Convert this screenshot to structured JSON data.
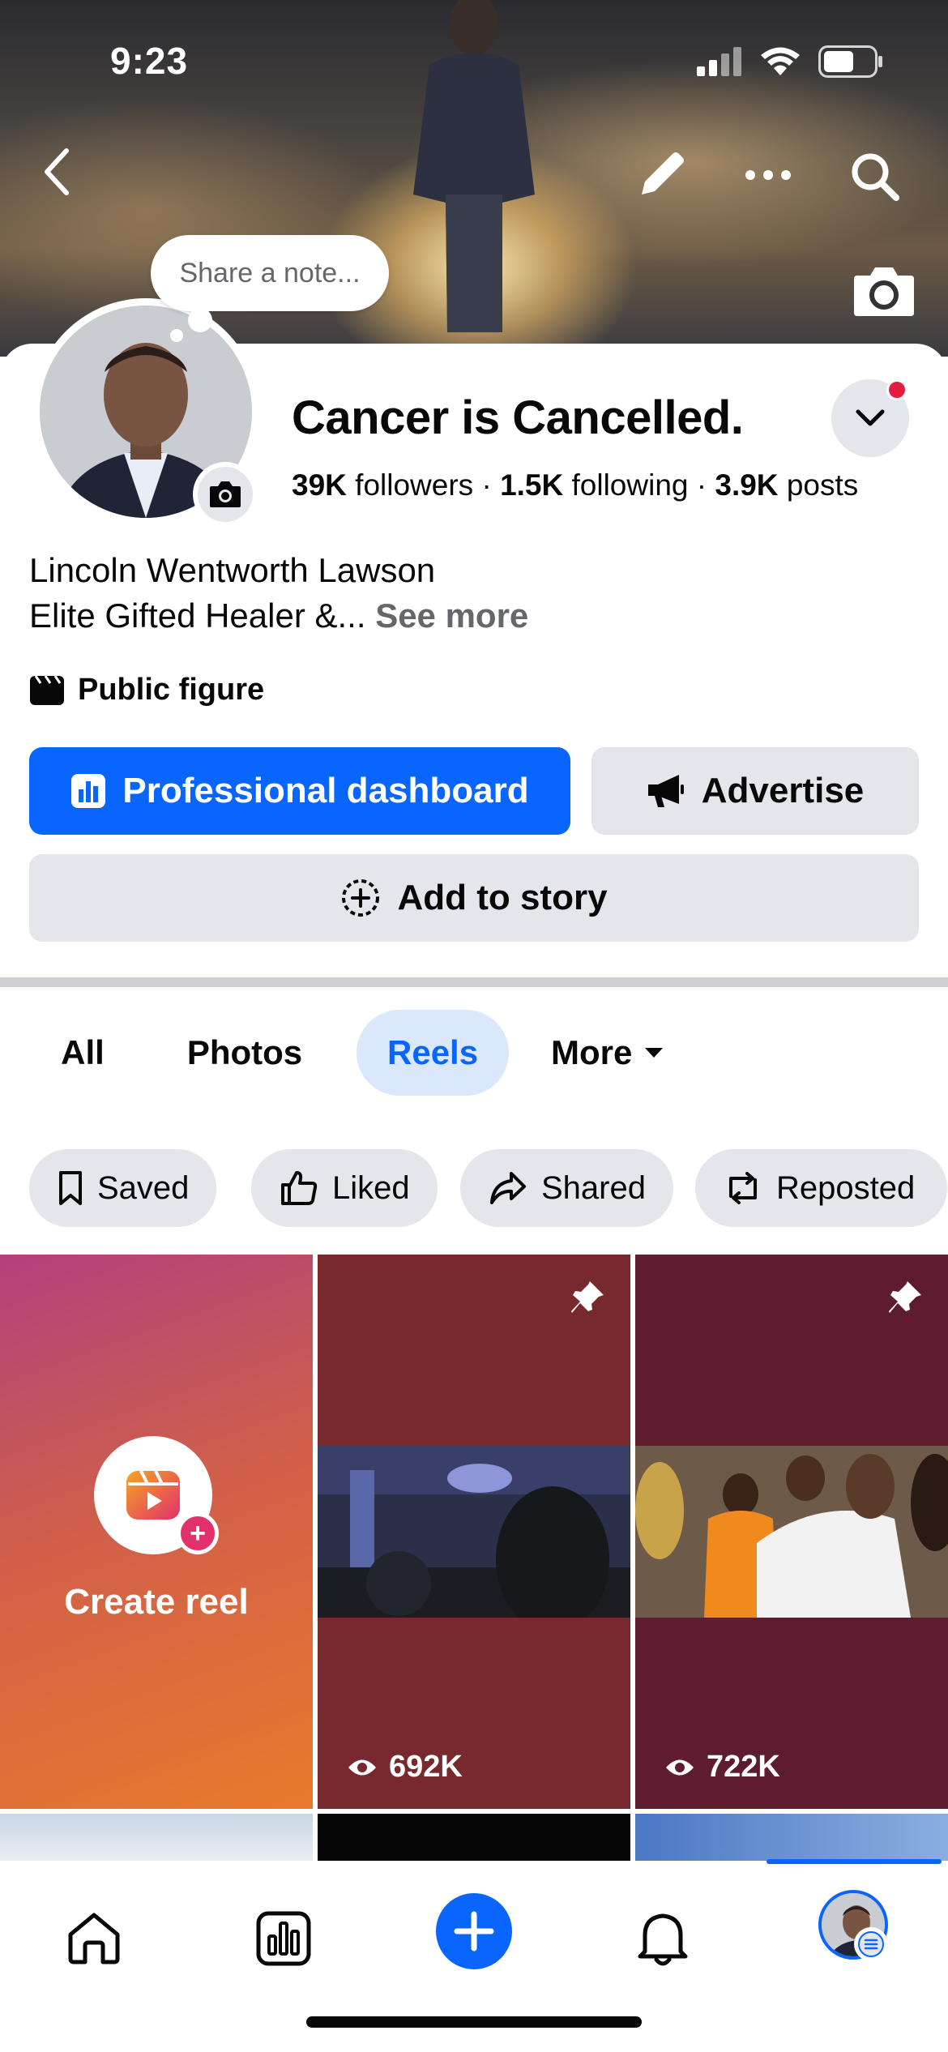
{
  "status_bar": {
    "time": "9:23"
  },
  "header": {
    "back_icon": "chevron-left-icon",
    "edit_icon": "pencil-icon",
    "more_icon": "ellipsis-icon",
    "search_icon": "search-icon",
    "cover_camera_icon": "camera-icon"
  },
  "note": {
    "placeholder": "Share a note..."
  },
  "profile": {
    "name": "Cancer is Cancelled.",
    "followers_count": "39K",
    "followers_label": "followers",
    "following_count": "1.5K",
    "following_label": "following",
    "posts_count": "3.9K",
    "posts_label": "posts",
    "separator": "·",
    "bio_line1": "Lincoln Wentworth Lawson",
    "bio_line2": "Elite Gifted Healer &...",
    "see_more": "See more",
    "category": "Public figure"
  },
  "actions": {
    "professional_dashboard": "Professional dashboard",
    "advertise": "Advertise",
    "add_to_story": "Add to story"
  },
  "tabs": [
    {
      "label": "All"
    },
    {
      "label": "Photos"
    },
    {
      "label": "Reels",
      "active": true
    },
    {
      "label": "More"
    }
  ],
  "filters": [
    {
      "label": "Saved",
      "icon": "bookmark-icon"
    },
    {
      "label": "Liked",
      "icon": "thumbs-up-icon"
    },
    {
      "label": "Shared",
      "icon": "share-arrow-icon"
    },
    {
      "label": "Reposted",
      "icon": "repost-icon"
    }
  ],
  "reels": {
    "create_label": "Create reel",
    "items": [
      {
        "views": "692K",
        "pinned": true
      },
      {
        "views": "722K",
        "pinned": true
      }
    ]
  },
  "bottom_nav": [
    {
      "name": "home",
      "icon": "home-icon"
    },
    {
      "name": "dashboard",
      "icon": "chart-icon"
    },
    {
      "name": "create",
      "icon": "plus-icon"
    },
    {
      "name": "notifications",
      "icon": "bell-icon"
    },
    {
      "name": "profile",
      "icon": "avatar-icon"
    }
  ],
  "colors": {
    "brand_blue": "#0866ff",
    "secondary_gray": "#e4e6eb",
    "notification_red": "#e41e3f",
    "active_tab_bg": "#dbe8fb"
  }
}
